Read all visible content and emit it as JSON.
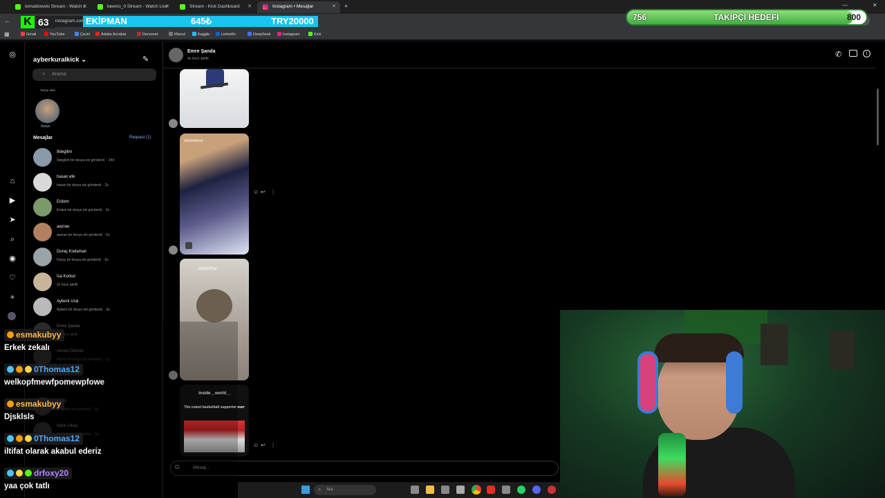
{
  "browser": {
    "tabs": [
      {
        "label": "tomaldowski Stream - Watch L",
        "color": "#53fc18"
      },
      {
        "label": "beemo_0 Stream - Watch Live",
        "color": "#53fc18"
      },
      {
        "label": "Stream - Kick Dashboard",
        "color": "#53fc18"
      },
      {
        "label": "Instagram • Mesajlar",
        "color": "#e1306c",
        "active": true
      }
    ],
    "url": "instagram.com",
    "bookmarks": [
      "Gmail",
      "YouTube",
      "Çeviri",
      "Adobe Acrobat",
      "Dersonet",
      "Misoul",
      "Kaggle",
      "LinkedIn",
      "DeepSeek",
      "Instagram",
      "Kick"
    ]
  },
  "stream_overlay": {
    "viewer_count": "63",
    "ticker": {
      "name": "EKİPMAN",
      "price": "645₺",
      "code": "TRY20000"
    },
    "goal": {
      "label": "TAKİPÇİ HEDEFİ",
      "current": "756",
      "target": "800",
      "progress": 0.945
    }
  },
  "instagram": {
    "account": "ayberkuralkick",
    "search_placeholder": "Arama",
    "note_label": "Tekrar ekle",
    "note_caption": "Notun",
    "messages_title": "Mesajlar",
    "requests": "Request (1)",
    "conversations": [
      {
        "name": "9degilim",
        "preview": "9degilim bir dosya eki gönderdi. · 24d"
      },
      {
        "name": "hasan efe",
        "preview": "hasan bir dosya eki gönderdi. · 2s"
      },
      {
        "name": "Erdem",
        "preview": "Erdem bir dosya eki gönderdi. · 2s"
      },
      {
        "name": "aazrae",
        "preview": "aazrae bir dosya eki gönderdi. · 5s"
      },
      {
        "name": "Duraç Kodaman",
        "preview": "Duraç bir dosya eki gönderdi. · 6s"
      },
      {
        "name": "İsa Korkut",
        "preview": "2s önce aktifti"
      },
      {
        "name": "Ayberk Ural",
        "preview": "Ayberk bir dosya eki gönderdi. · 9s"
      },
      {
        "name": "Emre Şanda",
        "preview": "4s önce aktifti"
      },
      {
        "name": "Ahmet Dikmen",
        "preview": "Ahmet bir dosya eki gönderdi. · 1g"
      },
      {
        "name": "Binici",
        "preview": "bir dosya eki gönderdi. · 1g"
      },
      {
        "name": "Narin Alkaç",
        "preview": "bir dosya eki gönderdi. · 1g"
      }
    ],
    "chat": {
      "name": "Emre Şanda",
      "status": "4s önce aktifti",
      "posts": [
        {
          "author": "shooverus"
        },
        {
          "author": "dailybffzar"
        },
        {
          "author": "inside__world__",
          "caption": "The cutest basketball supporter ever"
        }
      ],
      "message_placeholder": "Mesaj..."
    }
  },
  "taskbar": {
    "search_placeholder": "Ara"
  },
  "chat_overlay": [
    {
      "user": "esmakubyy",
      "color": "#ffb74d",
      "message": "Erkek zekalı"
    },
    {
      "user": "0Thomas12",
      "color": "#4fa8ff",
      "message": "welkopfmewfpomewpfowe"
    },
    {
      "user": "esmakubyy",
      "color": "#ffb74d",
      "message": "Djsklsls"
    },
    {
      "user": "0Thomas12",
      "color": "#4fa8ff",
      "message": "iltifat olarak akabul ederiz"
    },
    {
      "user": "drfoxy20",
      "color": "#b388ff",
      "message": "yaa çok tatlı"
    }
  ]
}
